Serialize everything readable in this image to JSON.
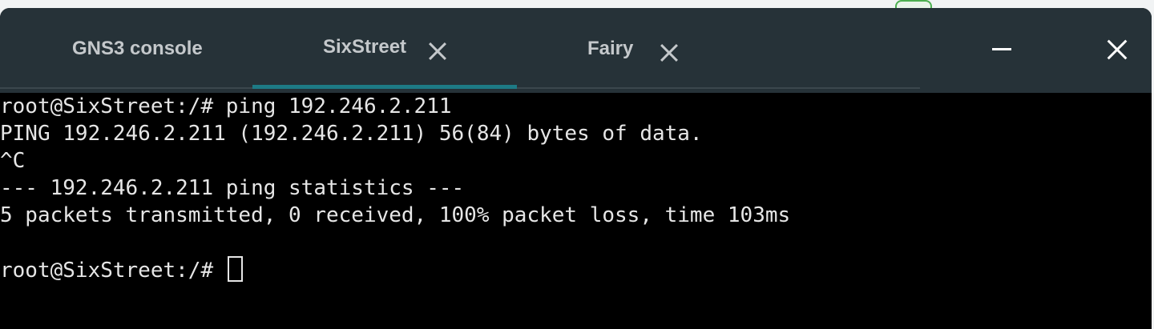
{
  "tabs": [
    {
      "label": "GNS3 console",
      "closable": false,
      "active": false
    },
    {
      "label": "SixStreet",
      "closable": true,
      "active": true
    },
    {
      "label": "Fairy",
      "closable": true,
      "active": false
    }
  ],
  "window_controls": {
    "minimize_icon": "minimize-icon",
    "close_icon": "close-icon"
  },
  "terminal": {
    "lines": [
      "root@SixStreet:/# ping 192.246.2.211",
      "PING 192.246.2.211 (192.246.2.211) 56(84) bytes of data.",
      "^C",
      "--- 192.246.2.211 ping statistics ---",
      "5 packets transmitted, 0 received, 100% packet loss, time 103ms",
      "",
      "root@SixStreet:/# "
    ]
  },
  "colors": {
    "titlebar": "#263238",
    "active_tab_indicator": "#1d7a85",
    "terminal_bg": "#000000",
    "terminal_fg": "#e6e6e6"
  }
}
